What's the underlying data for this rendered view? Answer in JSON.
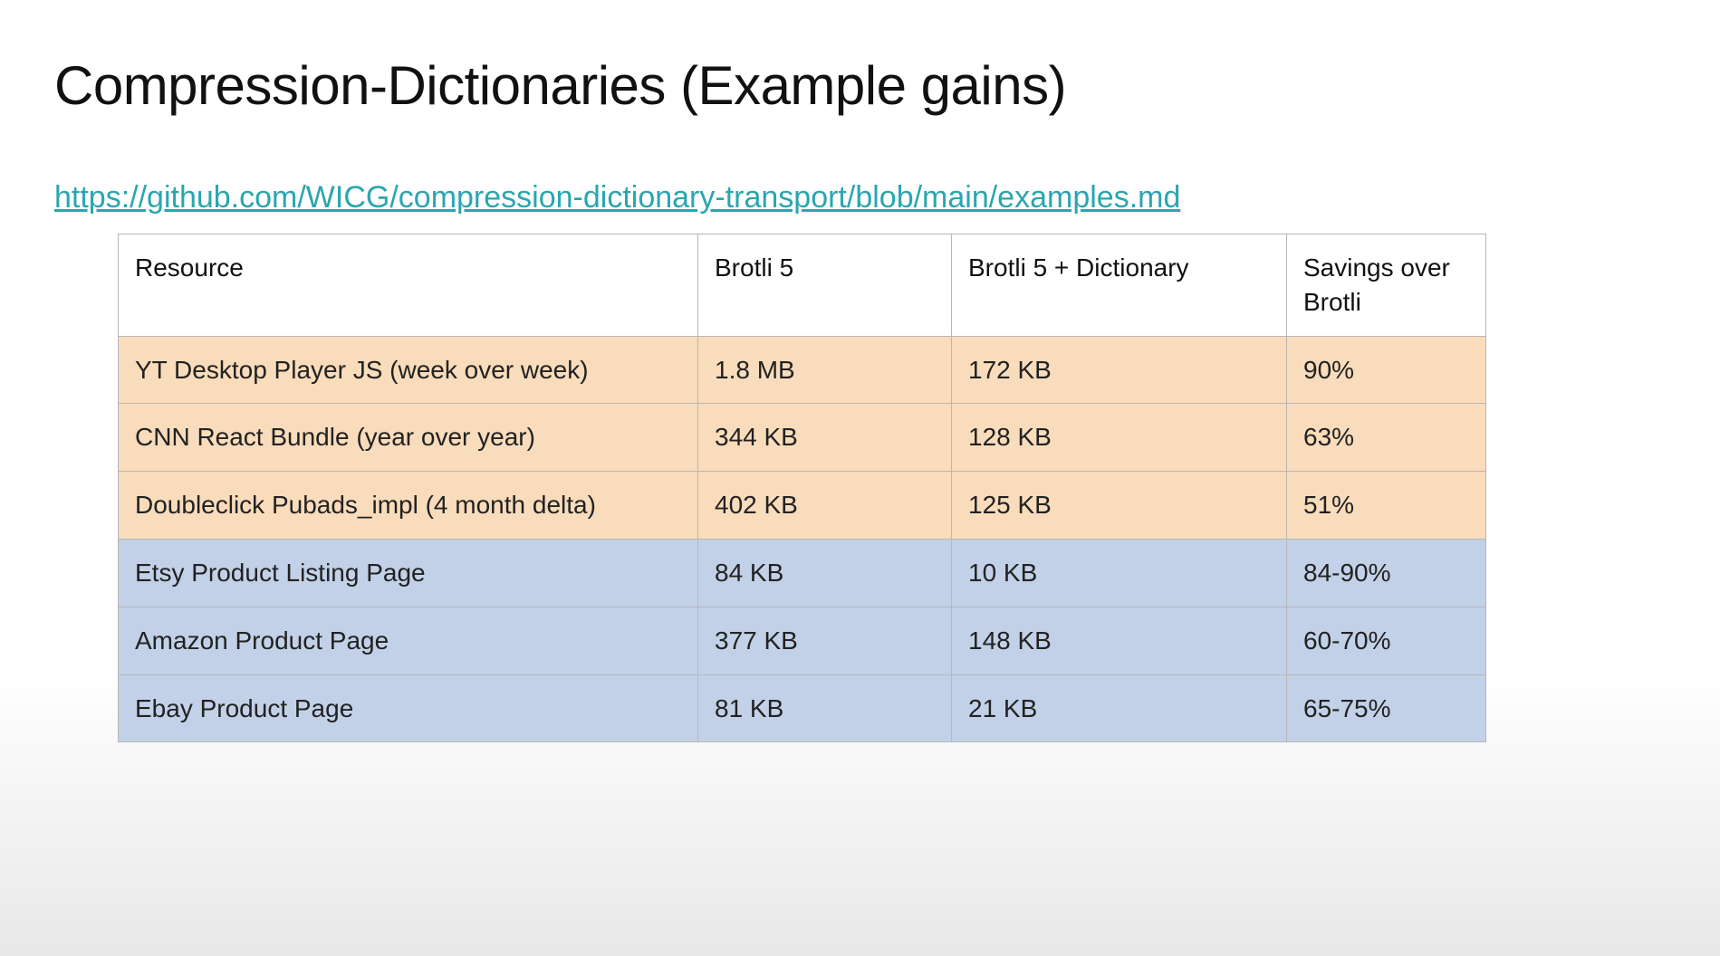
{
  "title": "Compression-Dictionaries (Example gains)",
  "link_text": "https://github.com/WICG/compression-dictionary-transport/blob/main/examples.md",
  "table": {
    "headers": {
      "resource": "Resource",
      "brotli5": "Brotli 5",
      "brotli5_dict": "Brotli 5 + Dictionary",
      "savings": "Savings over Brotli"
    },
    "rows": [
      {
        "group": "orange",
        "resource": "YT Desktop Player JS (week over week)",
        "brotli5": "1.8 MB",
        "brotli5_dict": "172 KB",
        "savings": "90%"
      },
      {
        "group": "orange",
        "resource": "CNN React Bundle (year over year)",
        "brotli5": "344 KB",
        "brotli5_dict": "128 KB",
        "savings": "63%"
      },
      {
        "group": "orange",
        "resource": "Doubleclick Pubads_impl (4 month delta)",
        "brotli5": "402 KB",
        "brotli5_dict": "125 KB",
        "savings": "51%"
      },
      {
        "group": "blue",
        "resource": "Etsy Product Listing Page",
        "brotli5": "84 KB",
        "brotli5_dict": "10 KB",
        "savings": "84-90%"
      },
      {
        "group": "blue",
        "resource": "Amazon Product Page",
        "brotli5": "377 KB",
        "brotli5_dict": "148 KB",
        "savings": "60-70%"
      },
      {
        "group": "blue",
        "resource": "Ebay Product Page",
        "brotli5": "81 KB",
        "brotli5_dict": "21 KB",
        "savings": "65-75%"
      }
    ]
  },
  "chart_data": {
    "type": "table",
    "title": "Compression-Dictionaries (Example gains)",
    "columns": [
      "Resource",
      "Brotli 5",
      "Brotli 5 + Dictionary",
      "Savings over Brotli"
    ],
    "rows": [
      [
        "YT Desktop Player JS (week over week)",
        "1.8 MB",
        "172 KB",
        "90%"
      ],
      [
        "CNN React Bundle (year over year)",
        "344 KB",
        "128 KB",
        "63%"
      ],
      [
        "Doubleclick Pubads_impl (4 month delta)",
        "402 KB",
        "125 KB",
        "51%"
      ],
      [
        "Etsy Product Listing Page",
        "84 KB",
        "10 KB",
        "84-90%"
      ],
      [
        "Amazon Product Page",
        "377 KB",
        "148 KB",
        "60-70%"
      ],
      [
        "Ebay Product Page",
        "81 KB",
        "21 KB",
        "65-75%"
      ]
    ]
  }
}
